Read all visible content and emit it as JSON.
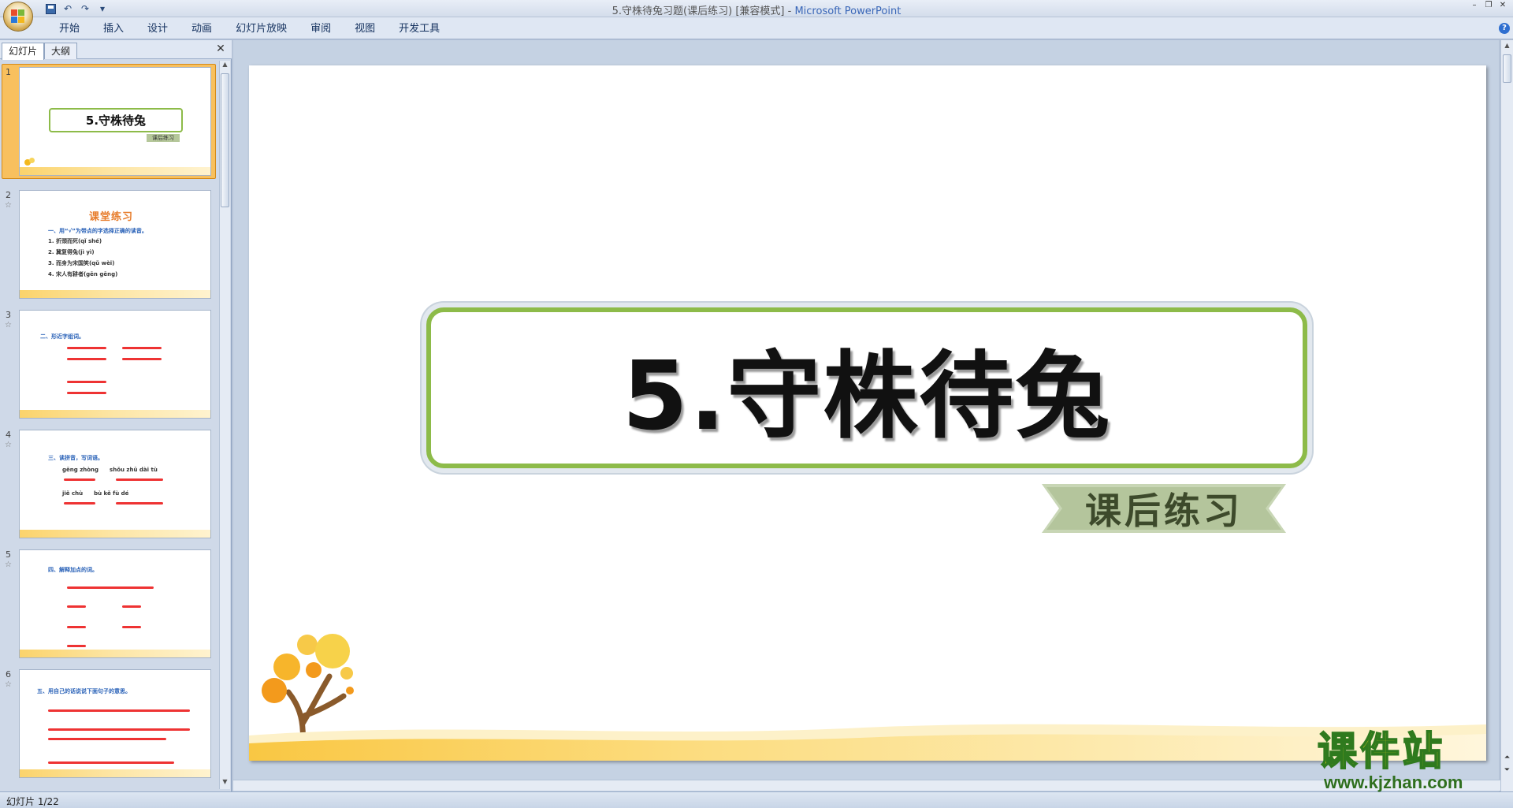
{
  "window": {
    "title": "5.守株待兔习题(课后练习) [兼容模式]",
    "app_name": "Microsoft PowerPoint"
  },
  "ribbon": {
    "tabs": [
      "开始",
      "插入",
      "设计",
      "动画",
      "幻灯片放映",
      "审阅",
      "视图",
      "开发工具"
    ]
  },
  "left_panel": {
    "tabs": [
      "幻灯片",
      "大纲"
    ],
    "thumbnails": [
      {
        "number": "1",
        "title": "5.守株待兔",
        "subtitle": "课后练习"
      },
      {
        "number": "2",
        "heading": "课堂练习",
        "lines": [
          "一、用“√”为带点的字选择正确的读音。",
          "1. 折颈而死(qǐ shé)",
          "2. 冀复得兔(jì yì)",
          "3. 而身为宋国笑(qǔ wèi)",
          "4. 宋人有耕者(gēn gēng)"
        ]
      },
      {
        "number": "3",
        "lines": [
          "二、形近字组词。"
        ]
      },
      {
        "number": "4",
        "lines": [
          "三、读拼音，写词语。",
          "gēng zhòng　　shǒu zhū dài tù",
          "jiě chù　　bù kě fù dé"
        ]
      },
      {
        "number": "5",
        "lines": [
          "四、解释加点的词。"
        ]
      },
      {
        "number": "6",
        "lines": [
          "五、用自己的话说说下面句子的意思。"
        ]
      }
    ]
  },
  "slide": {
    "title": "5.守株待兔",
    "subtitle": "课后练习"
  },
  "status": {
    "slide_indicator": "幻灯片 1/22"
  },
  "watermark": {
    "brand": "课件站",
    "url": "www.kjzhan.com"
  }
}
